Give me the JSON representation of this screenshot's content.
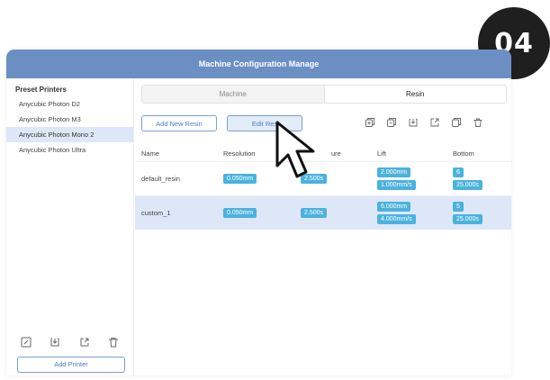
{
  "step_badge": "04",
  "window": {
    "title": "Machine Configuration Manage"
  },
  "sidebar": {
    "heading": "Preset Printers",
    "printers": [
      {
        "label": "Anycubic Photon D2",
        "selected": false
      },
      {
        "label": "Anycubic Photon M3",
        "selected": false
      },
      {
        "label": "Anycubic Photon Mono 2",
        "selected": true
      },
      {
        "label": "Anycubic Photon Ultra",
        "selected": false
      }
    ],
    "tools": [
      "edit-icon",
      "import-icon",
      "export-icon",
      "delete-icon"
    ],
    "add_printer": "Add Printer"
  },
  "tabs": [
    {
      "label": "Machine",
      "active": false
    },
    {
      "label": "Resin",
      "active": true
    }
  ],
  "toolbar": {
    "add_new_resin": "Add New Resin",
    "edit_resin": "Edit Res",
    "icons": [
      "add-copy-icon",
      "duplicate-icon",
      "import-icon",
      "export-icon",
      "copy-icon",
      "delete-icon"
    ]
  },
  "table": {
    "headers": {
      "name": "Name",
      "resolution": "Resolution",
      "exposure": "ure",
      "lift": "Lift",
      "bottom": "Bottom"
    },
    "rows": [
      {
        "name": "default_resin",
        "resolution": "0.050mm",
        "exposure": "2.500s",
        "lift_distance": "2.000mm",
        "lift_speed": "1.000mm/s",
        "bottom_layers": "6",
        "bottom_exposure": "25.000s",
        "selected": false
      },
      {
        "name": "custom_1",
        "resolution": "0.050mm",
        "exposure": "2.500s",
        "lift_distance": "6.000mm",
        "lift_speed": "4.000mm/s",
        "bottom_layers": "5",
        "bottom_exposure": "25.000s",
        "selected": true
      }
    ]
  },
  "colors": {
    "titlebar": "#6b8fc3",
    "accent": "#4d7cc4",
    "pill": "#4bb2de",
    "selection": "#dde7f7"
  }
}
